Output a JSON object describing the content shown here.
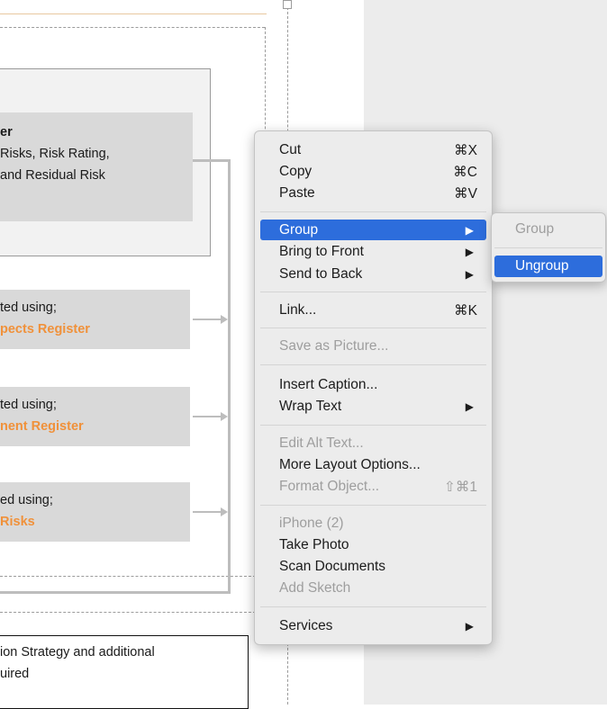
{
  "document": {
    "register_box": {
      "line1": "er",
      "line2": " Risks, Risk Rating,",
      "line3": " and Residual Risk"
    },
    "box1": {
      "line1": "ted using;",
      "line2": "pects Register"
    },
    "box2": {
      "line1": "ted using;",
      "line2": "nent Register"
    },
    "box3": {
      "line1": "ed using;",
      "line2": "Risks"
    },
    "bottom_box": {
      "line1": "ion Strategy and additional",
      "line2": "uired"
    }
  },
  "context_menu": {
    "items": [
      {
        "label": "Cut",
        "shortcut": "⌘X"
      },
      {
        "label": "Copy",
        "shortcut": "⌘C"
      },
      {
        "label": "Paste",
        "shortcut": "⌘V"
      },
      {
        "label": "Group",
        "arrow": "▶",
        "state": "highlighted"
      },
      {
        "label": "Bring to Front",
        "arrow": "▶"
      },
      {
        "label": "Send to Back",
        "arrow": "▶"
      },
      {
        "label": "Link...",
        "shortcut": "⌘K"
      },
      {
        "label": "Save as Picture...",
        "state": "disabled"
      },
      {
        "label": "Insert Caption..."
      },
      {
        "label": "Wrap Text",
        "arrow": "▶"
      },
      {
        "label": "Edit Alt Text...",
        "state": "disabled"
      },
      {
        "label": "More Layout Options..."
      },
      {
        "label": "Format Object...",
        "shortcut": "⇧⌘1",
        "state": "disabled"
      },
      {
        "label": "iPhone (2)",
        "state": "disabled"
      },
      {
        "label": "Take Photo"
      },
      {
        "label": "Scan Documents"
      },
      {
        "label": "Add Sketch",
        "state": "disabled"
      },
      {
        "label": "Services",
        "arrow": "▶"
      }
    ]
  },
  "submenu": {
    "items": [
      {
        "label": "Group",
        "state": "disabled"
      },
      {
        "label": "Ungroup",
        "state": "highlighted"
      }
    ]
  },
  "colors": {
    "highlight": "#2d6ddc",
    "orange_text": "#f0913a",
    "menu_bg": "#ececec",
    "disabled_text": "#9e9e9e"
  }
}
